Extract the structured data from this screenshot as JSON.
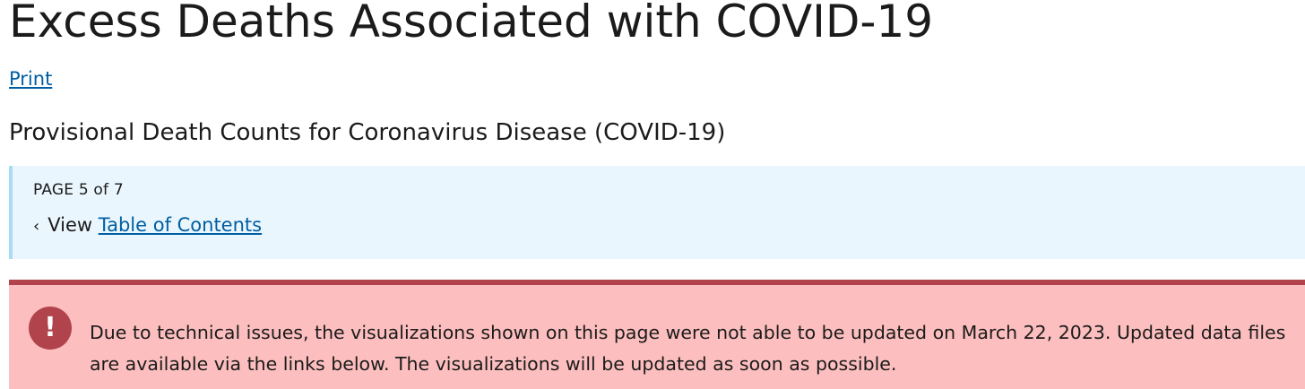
{
  "header": {
    "title": "Excess Deaths Associated with COVID-19",
    "print_label": "Print"
  },
  "main": {
    "subtitle": "Provisional Death Counts for Coronavirus Disease (COVID-19)",
    "pager": {
      "count_text": "PAGE 5 of 7",
      "chevron": "‹",
      "view_label": "View",
      "toc_link_label": "Table of Contents"
    },
    "alert": {
      "icon": "exclamation-icon",
      "icon_glyph": "!",
      "message": "Due to technical issues, the visualizations shown on this page were not able to be updated on March 22, 2023. Updated data files are available via the links below. The visualizations will be updated as soon as possible."
    }
  },
  "colors": {
    "link": "#005ea2",
    "info_background": "#eaf6fd",
    "info_border": "#a8dcf5",
    "alert_background": "#fcbebe",
    "alert_accent": "#b0434b"
  }
}
